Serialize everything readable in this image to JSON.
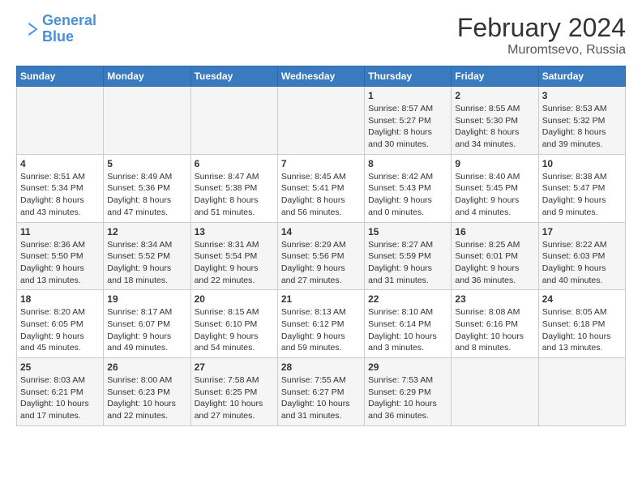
{
  "header": {
    "logo_line1": "General",
    "logo_line2": "Blue",
    "title": "February 2024",
    "subtitle": "Muromtsevo, Russia"
  },
  "days_of_week": [
    "Sunday",
    "Monday",
    "Tuesday",
    "Wednesday",
    "Thursday",
    "Friday",
    "Saturday"
  ],
  "weeks": [
    [
      {
        "day": "",
        "info": ""
      },
      {
        "day": "",
        "info": ""
      },
      {
        "day": "",
        "info": ""
      },
      {
        "day": "",
        "info": ""
      },
      {
        "day": "1",
        "info": "Sunrise: 8:57 AM\nSunset: 5:27 PM\nDaylight: 8 hours\nand 30 minutes."
      },
      {
        "day": "2",
        "info": "Sunrise: 8:55 AM\nSunset: 5:30 PM\nDaylight: 8 hours\nand 34 minutes."
      },
      {
        "day": "3",
        "info": "Sunrise: 8:53 AM\nSunset: 5:32 PM\nDaylight: 8 hours\nand 39 minutes."
      }
    ],
    [
      {
        "day": "4",
        "info": "Sunrise: 8:51 AM\nSunset: 5:34 PM\nDaylight: 8 hours\nand 43 minutes."
      },
      {
        "day": "5",
        "info": "Sunrise: 8:49 AM\nSunset: 5:36 PM\nDaylight: 8 hours\nand 47 minutes."
      },
      {
        "day": "6",
        "info": "Sunrise: 8:47 AM\nSunset: 5:38 PM\nDaylight: 8 hours\nand 51 minutes."
      },
      {
        "day": "7",
        "info": "Sunrise: 8:45 AM\nSunset: 5:41 PM\nDaylight: 8 hours\nand 56 minutes."
      },
      {
        "day": "8",
        "info": "Sunrise: 8:42 AM\nSunset: 5:43 PM\nDaylight: 9 hours\nand 0 minutes."
      },
      {
        "day": "9",
        "info": "Sunrise: 8:40 AM\nSunset: 5:45 PM\nDaylight: 9 hours\nand 4 minutes."
      },
      {
        "day": "10",
        "info": "Sunrise: 8:38 AM\nSunset: 5:47 PM\nDaylight: 9 hours\nand 9 minutes."
      }
    ],
    [
      {
        "day": "11",
        "info": "Sunrise: 8:36 AM\nSunset: 5:50 PM\nDaylight: 9 hours\nand 13 minutes."
      },
      {
        "day": "12",
        "info": "Sunrise: 8:34 AM\nSunset: 5:52 PM\nDaylight: 9 hours\nand 18 minutes."
      },
      {
        "day": "13",
        "info": "Sunrise: 8:31 AM\nSunset: 5:54 PM\nDaylight: 9 hours\nand 22 minutes."
      },
      {
        "day": "14",
        "info": "Sunrise: 8:29 AM\nSunset: 5:56 PM\nDaylight: 9 hours\nand 27 minutes."
      },
      {
        "day": "15",
        "info": "Sunrise: 8:27 AM\nSunset: 5:59 PM\nDaylight: 9 hours\nand 31 minutes."
      },
      {
        "day": "16",
        "info": "Sunrise: 8:25 AM\nSunset: 6:01 PM\nDaylight: 9 hours\nand 36 minutes."
      },
      {
        "day": "17",
        "info": "Sunrise: 8:22 AM\nSunset: 6:03 PM\nDaylight: 9 hours\nand 40 minutes."
      }
    ],
    [
      {
        "day": "18",
        "info": "Sunrise: 8:20 AM\nSunset: 6:05 PM\nDaylight: 9 hours\nand 45 minutes."
      },
      {
        "day": "19",
        "info": "Sunrise: 8:17 AM\nSunset: 6:07 PM\nDaylight: 9 hours\nand 49 minutes."
      },
      {
        "day": "20",
        "info": "Sunrise: 8:15 AM\nSunset: 6:10 PM\nDaylight: 9 hours\nand 54 minutes."
      },
      {
        "day": "21",
        "info": "Sunrise: 8:13 AM\nSunset: 6:12 PM\nDaylight: 9 hours\nand 59 minutes."
      },
      {
        "day": "22",
        "info": "Sunrise: 8:10 AM\nSunset: 6:14 PM\nDaylight: 10 hours\nand 3 minutes."
      },
      {
        "day": "23",
        "info": "Sunrise: 8:08 AM\nSunset: 6:16 PM\nDaylight: 10 hours\nand 8 minutes."
      },
      {
        "day": "24",
        "info": "Sunrise: 8:05 AM\nSunset: 6:18 PM\nDaylight: 10 hours\nand 13 minutes."
      }
    ],
    [
      {
        "day": "25",
        "info": "Sunrise: 8:03 AM\nSunset: 6:21 PM\nDaylight: 10 hours\nand 17 minutes."
      },
      {
        "day": "26",
        "info": "Sunrise: 8:00 AM\nSunset: 6:23 PM\nDaylight: 10 hours\nand 22 minutes."
      },
      {
        "day": "27",
        "info": "Sunrise: 7:58 AM\nSunset: 6:25 PM\nDaylight: 10 hours\nand 27 minutes."
      },
      {
        "day": "28",
        "info": "Sunrise: 7:55 AM\nSunset: 6:27 PM\nDaylight: 10 hours\nand 31 minutes."
      },
      {
        "day": "29",
        "info": "Sunrise: 7:53 AM\nSunset: 6:29 PM\nDaylight: 10 hours\nand 36 minutes."
      },
      {
        "day": "",
        "info": ""
      },
      {
        "day": "",
        "info": ""
      }
    ]
  ]
}
